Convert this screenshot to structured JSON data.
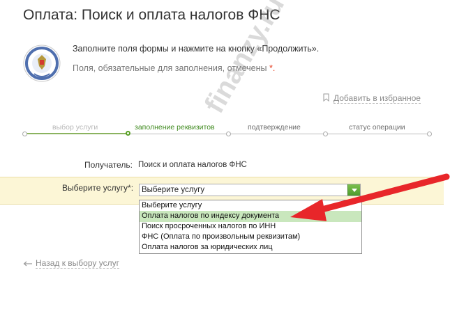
{
  "page": {
    "title": "Оплата: Поиск и оплата налогов ФНС",
    "instruction": "Заполните поля формы и нажмите на кнопку «Продолжить».",
    "required_note": "Поля, обязательные для заполнения, отмечены",
    "required_star": "*."
  },
  "favorites": {
    "label": "Добавить в избранное",
    "icon": "bookmark-icon"
  },
  "steps": [
    {
      "label": "выбор услуги",
      "state": "done"
    },
    {
      "label": "заполнение реквизитов",
      "state": "active"
    },
    {
      "label": "подтверждение",
      "state": "pending"
    },
    {
      "label": "статус операции",
      "state": "pending"
    }
  ],
  "form": {
    "recipient_label": "Получатель:",
    "recipient_value": "Поиск и оплата налогов ФНС",
    "service_label": "Выберите услугу*:",
    "service_selected": "Выберите услугу",
    "service_options": [
      "Выберите услугу",
      "Оплата налогов по индексу документа",
      "Поиск просроченных налогов по ИНН",
      "ФНС (Оплата по произвольным реквизитам)",
      "Оплата налогов за юридических лиц"
    ],
    "highlighted_option_index": 1
  },
  "back_link": {
    "label": "Назад к выбору услуг",
    "icon": "arrow-left-icon"
  },
  "watermark": "finanzy.ru",
  "colors": {
    "accent_green": "#58a025",
    "highlight_band": "#fcf6d6",
    "selected_option": "#c9e7bd",
    "arrow_red": "#e8262a"
  }
}
